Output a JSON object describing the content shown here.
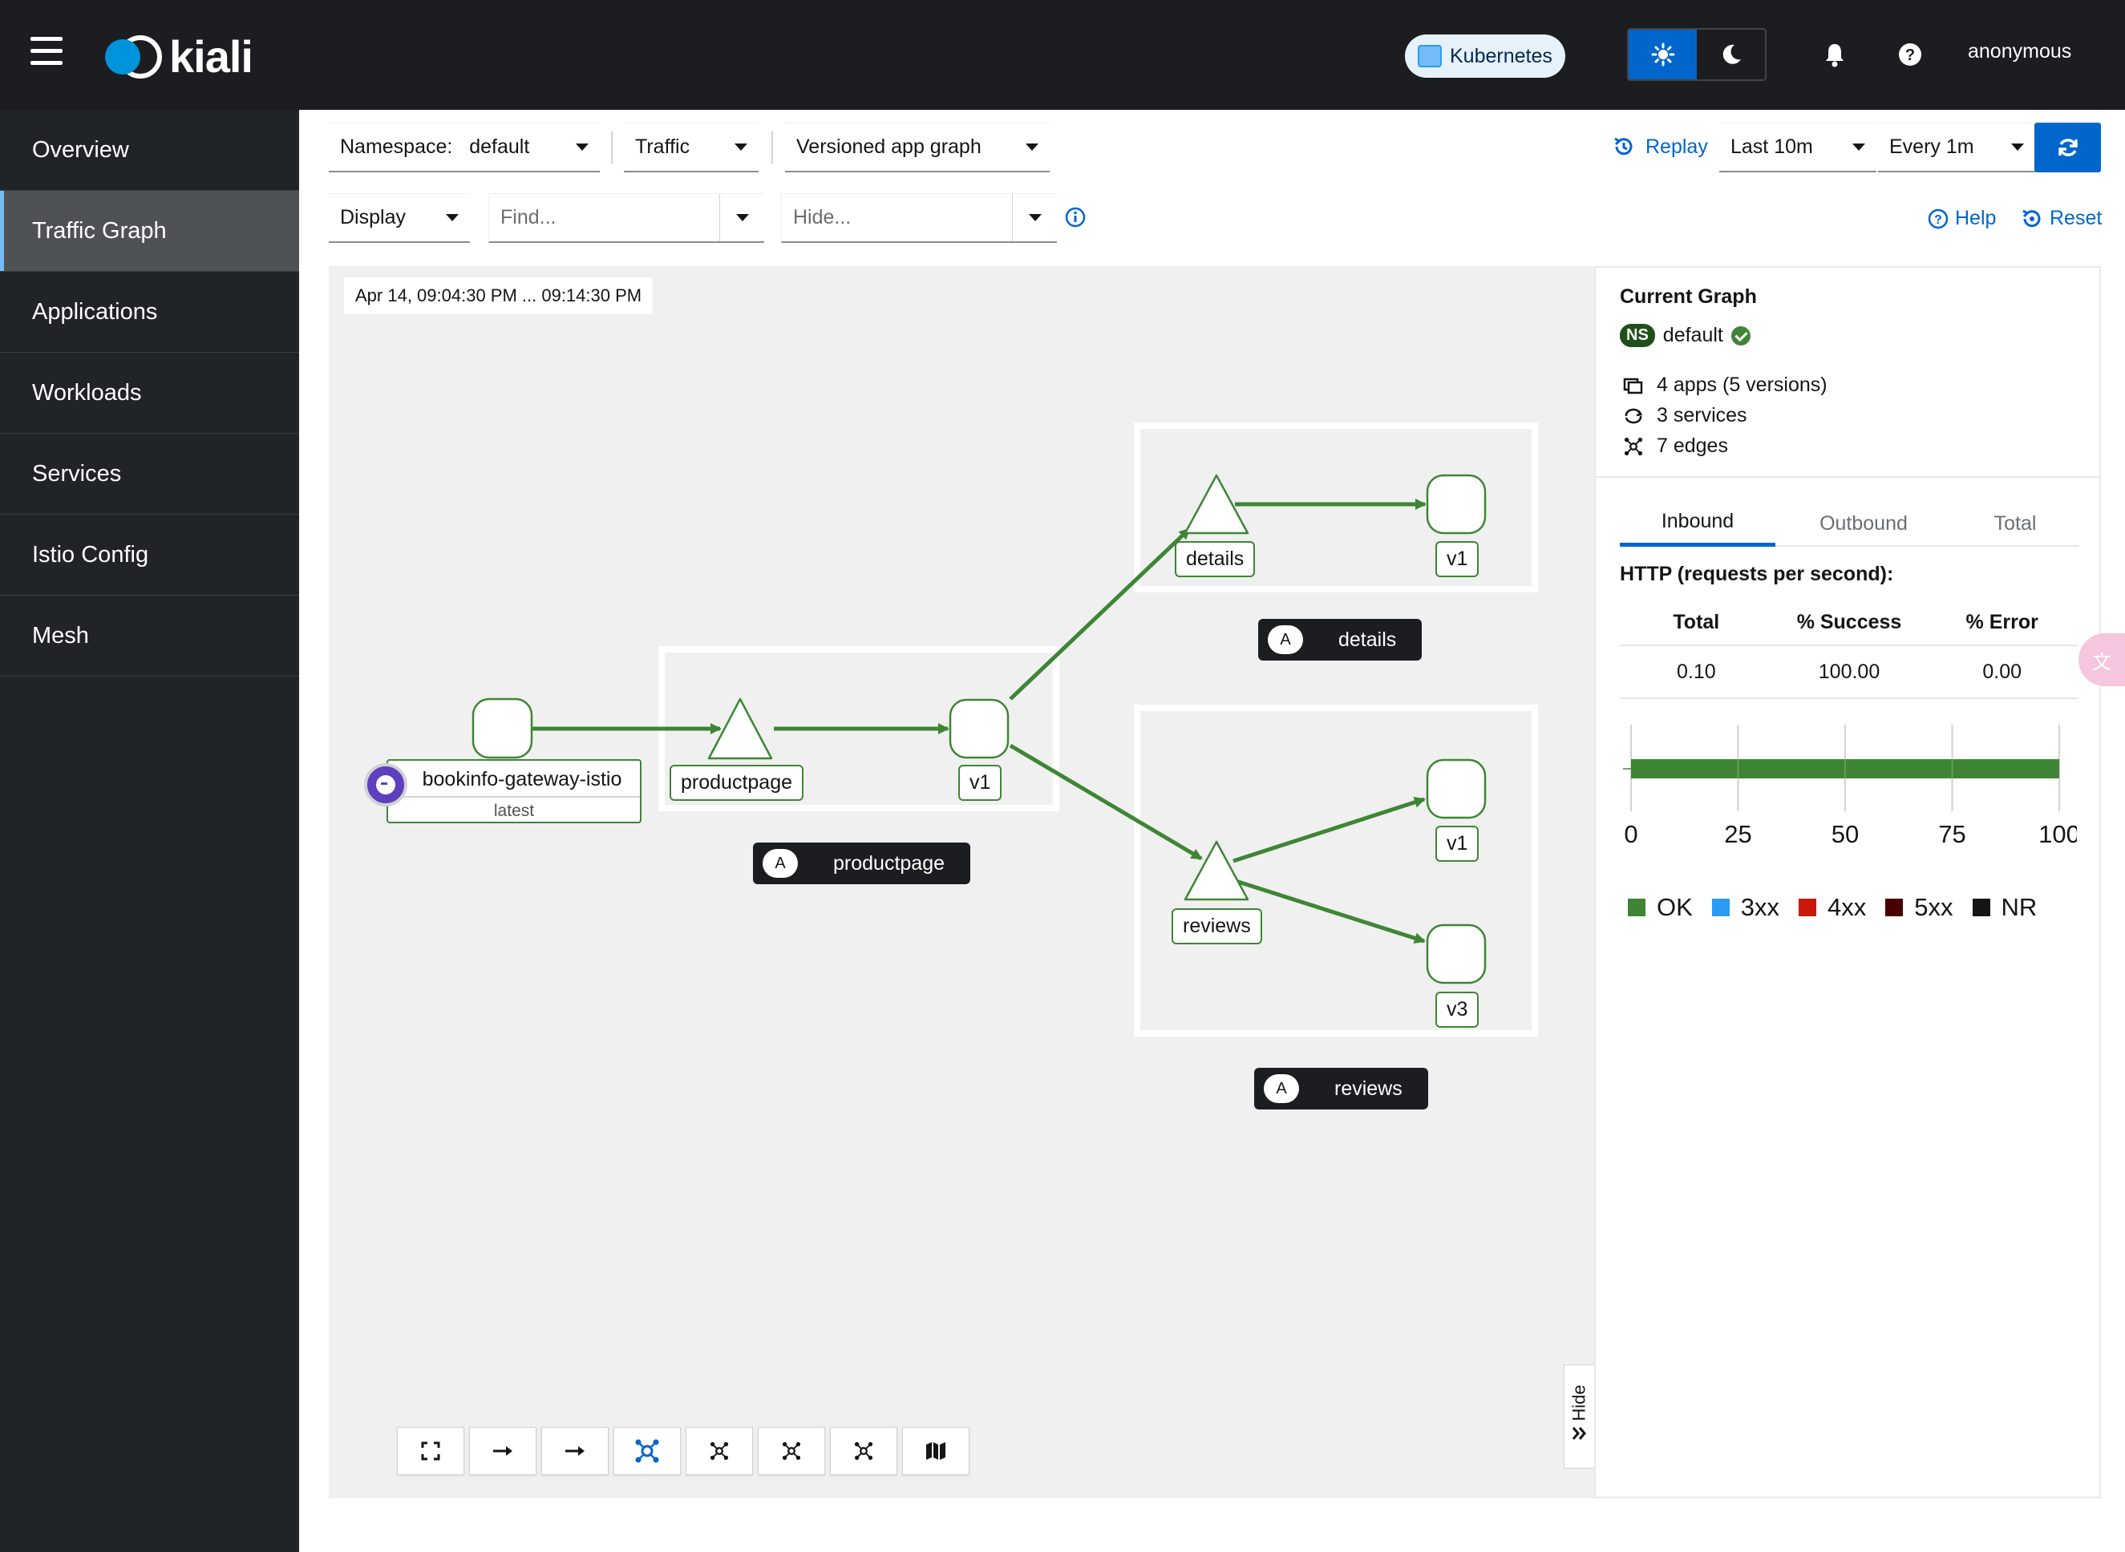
{
  "header": {
    "logo_text": "kiali",
    "cluster_label": "Kubernetes",
    "user": "anonymous"
  },
  "sidebar": {
    "items": [
      {
        "label": "Overview",
        "active": false
      },
      {
        "label": "Traffic Graph",
        "active": true
      },
      {
        "label": "Applications",
        "active": false
      },
      {
        "label": "Workloads",
        "active": false
      },
      {
        "label": "Services",
        "active": false
      },
      {
        "label": "Istio Config",
        "active": false
      },
      {
        "label": "Mesh",
        "active": false
      }
    ]
  },
  "toolbar": {
    "namespace_label": "Namespace:",
    "namespace_value": "default",
    "traffic_label": "Traffic",
    "graph_type": "Versioned app graph",
    "replay_label": "Replay",
    "duration": "Last 10m",
    "refresh_interval": "Every 1m",
    "display_label": "Display",
    "find_placeholder": "Find...",
    "hide_placeholder": "Hide...",
    "help_label": "Help",
    "reset_label": "Reset"
  },
  "graph": {
    "timestamp": "Apr 14, 09:04:30 PM ... 09:14:30 PM",
    "gateway": {
      "name": "bookinfo-gateway-istio",
      "version": "latest"
    },
    "nodes": {
      "productpage_service": "productpage",
      "productpage_v1": "v1",
      "details_service": "details",
      "details_v1": "v1",
      "reviews_service": "reviews",
      "reviews_v1": "v1",
      "reviews_v3": "v3"
    },
    "app_boxes": {
      "productpage": {
        "badge": "A",
        "name": "productpage"
      },
      "details": {
        "badge": "A",
        "name": "details"
      },
      "reviews": {
        "badge": "A",
        "name": "reviews"
      }
    },
    "hide_tab_label": "Hide",
    "edge_color": "#3e8635"
  },
  "panel": {
    "title": "Current Graph",
    "ns_badge": "NS",
    "namespace": "default",
    "apps": "4 apps (5 versions)",
    "services": "3 services",
    "edges": "7 edges",
    "tabs": [
      "Inbound",
      "Outbound",
      "Total"
    ],
    "active_tab": "Inbound",
    "http_title": "HTTP (requests per second):",
    "table": {
      "headers": [
        "Total",
        "% Success",
        "% Error"
      ],
      "values": [
        "0.10",
        "100.00",
        "0.00"
      ]
    }
  },
  "chart_data": {
    "type": "bar",
    "orientation": "horizontal",
    "categories": [
      ""
    ],
    "series": [
      {
        "name": "OK",
        "values": [
          100
        ],
        "color": "#3e8635"
      },
      {
        "name": "3xx",
        "values": [
          0
        ],
        "color": "#2b9af3"
      },
      {
        "name": "4xx",
        "values": [
          0
        ],
        "color": "#c9190b"
      },
      {
        "name": "5xx",
        "values": [
          0
        ],
        "color": "#470000"
      },
      {
        "name": "NR",
        "values": [
          0
        ],
        "color": "#151515"
      }
    ],
    "x_ticks": [
      "0",
      "25",
      "50",
      "75",
      "100"
    ],
    "xlim": [
      0,
      100
    ],
    "grid": true,
    "legend_position": "bottom"
  }
}
